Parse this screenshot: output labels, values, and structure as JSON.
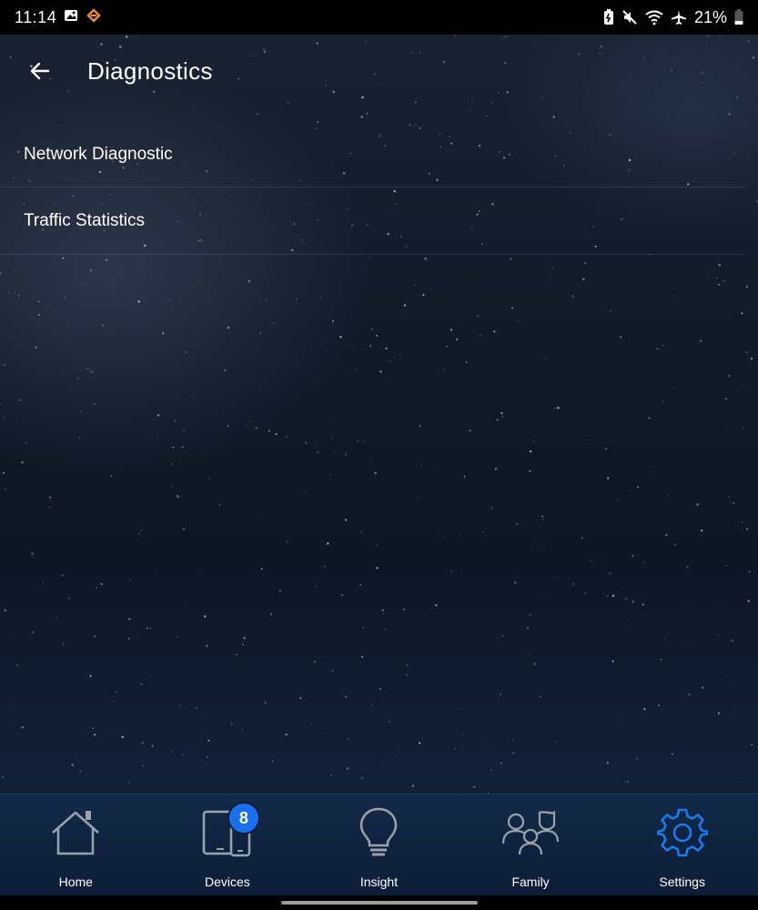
{
  "status_bar": {
    "time": "11:14",
    "battery": "21%",
    "left_icons": [
      "gallery-icon",
      "app-notification-icon"
    ],
    "right_icons": [
      "battery-saver-icon",
      "mute-icon",
      "wifi-icon",
      "airplane-icon",
      "battery-icon"
    ]
  },
  "header": {
    "title": "Diagnostics",
    "back_icon": "arrow-left-icon"
  },
  "menu": {
    "items": [
      {
        "label": "Network Diagnostic"
      },
      {
        "label": "Traffic Statistics"
      }
    ]
  },
  "bottom_nav": {
    "items": [
      {
        "label": "Home",
        "icon": "home-icon",
        "active": false
      },
      {
        "label": "Devices",
        "icon": "devices-icon",
        "active": false,
        "badge": "8"
      },
      {
        "label": "Insight",
        "icon": "lightbulb-icon",
        "active": false
      },
      {
        "label": "Family",
        "icon": "family-icon",
        "active": false
      },
      {
        "label": "Settings",
        "icon": "gear-icon",
        "active": true
      }
    ]
  },
  "colors": {
    "accent": "#1a6ff0",
    "nav_background": "#0c1d36",
    "icon_inactive": "#9aa3ad"
  }
}
